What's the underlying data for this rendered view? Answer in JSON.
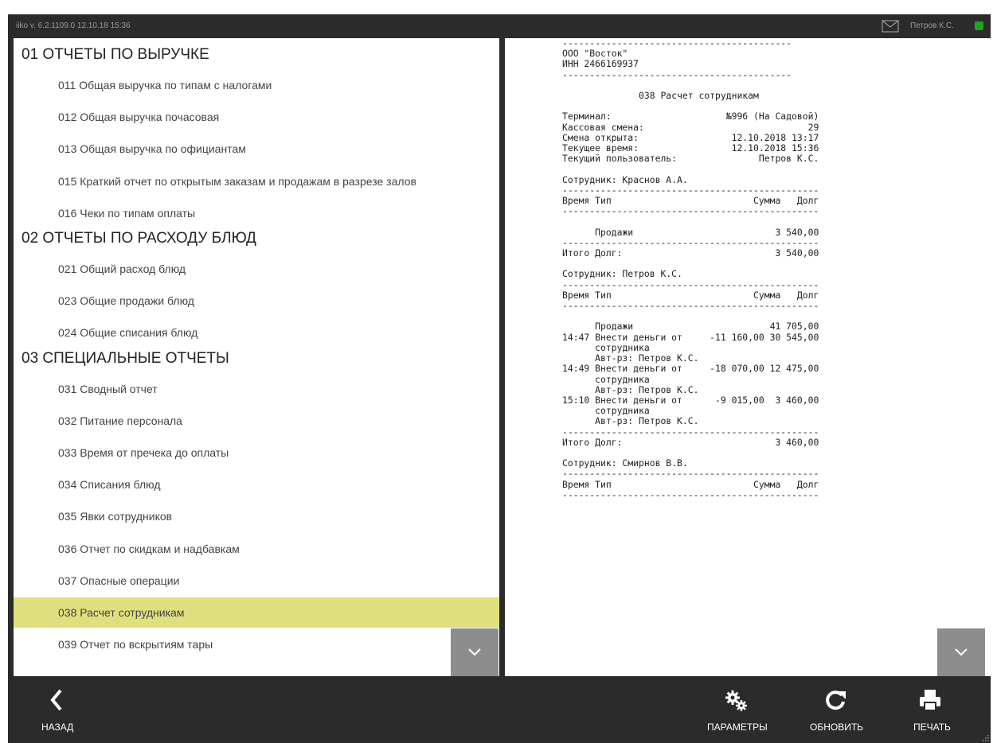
{
  "topbar": {
    "version": "iiko v. 6.2.1109.0   12.10.18  15:36",
    "user": "Петров К.С.",
    "icons": {
      "mail": "mail-icon",
      "status": "status-indicator"
    },
    "status_color": "#21a121"
  },
  "menu": {
    "sections": [
      {
        "title": "01 ОТЧЕТЫ ПО ВЫРУЧКЕ",
        "items": [
          "011 Общая выручка по типам с налогами",
          "012 Общая выручка почасовая",
          "013 Общая выручка по официантам",
          "015 Краткий отчет по открытым заказам и продажам в разрезе залов",
          "016 Чеки по типам оплаты"
        ]
      },
      {
        "title": "02 ОТЧЕТЫ ПО РАСХОДУ БЛЮД",
        "items": [
          "021 Общий расход блюд",
          "023 Общие продажи блюд",
          "024 Общие списания блюд"
        ]
      },
      {
        "title": "03 СПЕЦИАЛЬНЫЕ ОТЧЕТЫ",
        "items": [
          "031 Сводный отчет",
          "032 Питание персонала",
          "033 Время от пречека до оплаты",
          "034 Списания блюд",
          "035 Явки сотрудников",
          "036 Отчет по скидкам и надбавкам",
          "037 Опасные операции",
          "038 Расчет сотрудникам",
          "039 Отчет по вскрытиям тары"
        ]
      }
    ],
    "selected": "038 Расчет сотрудникам",
    "selected_color": "#dfe07d"
  },
  "report": {
    "lines": [
      "------------------------------------------",
      "ООО \"Восток\"",
      "ИНН 2466169937",
      "------------------------------------------",
      "",
      "              038 Расчет сотрудникам",
      "",
      "Терминал:                     №996 (На Садовой)",
      "Кассовая смена:                              29",
      "Смена открыта:                 12.10.2018 13:17",
      "Текущее время:                 12.10.2018 15:36",
      "Текущий пользователь:               Петров К.С.",
      "",
      "Сотрудник: Краснов А.А.",
      "-----------------------------------------------",
      "Время Тип                          Сумма   Долг",
      "-----------------------------------------------",
      "",
      "      Продажи                          3 540,00",
      "-----------------------------------------------",
      "Итого Долг:                            3 540,00",
      "",
      "Сотрудник: Петров К.С.",
      "-----------------------------------------------",
      "Время Тип                          Сумма   Долг",
      "-----------------------------------------------",
      "",
      "      Продажи                         41 705,00",
      "14:47 Внести деньги от     -11 160,00 30 545,00",
      "      сотрудника",
      "      Авт-рз: Петров К.С.",
      "14:49 Внести деньги от     -18 070,00 12 475,00",
      "      сотрудника",
      "      Авт-рз: Петров К.С.",
      "15:10 Внести деньги от      -9 015,00  3 460,00",
      "      сотрудника",
      "      Авт-рз: Петров К.С.",
      "-----------------------------------------------",
      "Итого Долг:                            3 460,00",
      "",
      "Сотрудник: Смирнов В.В.",
      "-----------------------------------------------",
      "Время Тип                          Сумма   Долг",
      "-----------------------------------------------",
      ""
    ]
  },
  "toolbar": {
    "back": {
      "label": "НАЗАД",
      "icon": "chevron-left-icon"
    },
    "params": {
      "label": "ПАРАМЕТРЫ",
      "icon": "gears-icon"
    },
    "refresh": {
      "label": "ОБНОВИТЬ",
      "icon": "refresh-icon"
    },
    "print": {
      "label": "ПЕЧАТЬ",
      "icon": "printer-icon"
    }
  },
  "scroll_icon": "chevron-down-icon"
}
